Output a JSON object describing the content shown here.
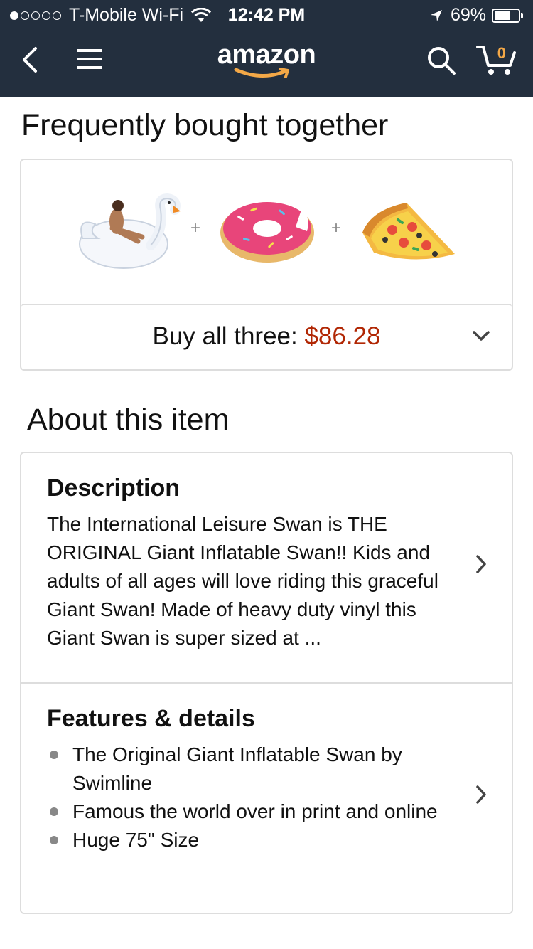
{
  "status_bar": {
    "carrier": "T-Mobile Wi-Fi",
    "time": "12:42 PM",
    "battery": "69%",
    "battery_level": 0.69,
    "signal_bars": 1
  },
  "nav": {
    "logo": "amazon",
    "cart_count": "0",
    "icons": [
      "back-icon",
      "menu-icon",
      "search-icon",
      "cart-icon"
    ],
    "brand_color": "#232f3e",
    "accent_color": "#f3a847"
  },
  "frequently_bought": {
    "title": "Frequently bought together",
    "products": [
      "swan-float-image",
      "donut-float-image",
      "pizza-float-image"
    ],
    "plus": "+",
    "buy_label": "Buy all three:",
    "price": "$86.28",
    "price_color": "#b12704"
  },
  "about": {
    "title": "About this item",
    "description": {
      "title": "Description",
      "text": "The International Leisure Swan is THE ORIGINAL Giant Inflatable Swan!! Kids and adults of all ages will love riding this graceful Giant Swan! Made of heavy duty vinyl this Giant Swan is super sized at ..."
    },
    "features": {
      "title": "Features & details",
      "items": [
        "The Original Giant Inflatable Swan by Swimline",
        "Famous the world over in print and online",
        "Huge 75\" Size"
      ]
    }
  }
}
